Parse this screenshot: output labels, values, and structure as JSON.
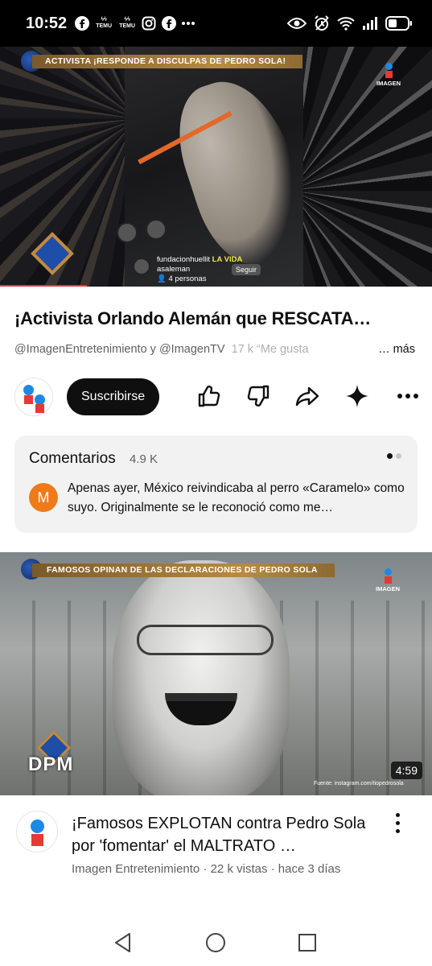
{
  "status_bar": {
    "time": "10:52",
    "temu_label": "TEMU",
    "icons": [
      "facebook-icon",
      "temu-icon",
      "temu-icon",
      "instagram-icon",
      "facebook-icon",
      "more-icon",
      "eye-icon",
      "alarm-icon",
      "wifi-icon",
      "signal-icon",
      "battery-icon"
    ]
  },
  "player": {
    "banner_text": "ACTIVISTA ¡RESPONDE A DISCULPAS DE PEDRO SOLA!",
    "logo_text": "IMAGEN",
    "live_username": "fundacionhuellit",
    "live_overlay_tag": "LA VIDA",
    "live_handle": "asaleman",
    "live_viewers": "4 personas",
    "live_follow": "Seguir"
  },
  "video": {
    "title": "¡Activista Orlando Alemán que RESCATA…",
    "channels": "@ImagenEntretenimiento y @ImagenTV",
    "likes": "17 k “Me gusta",
    "more": "… más",
    "subscribe_label": "Suscribirse"
  },
  "comments": {
    "header": "Comentarios",
    "count": "4.9 K",
    "avatar_letter": "M",
    "text": "Apenas ayer, México reivindicaba al perro «Caramelo» como suyo. Originalmente se le reconoció como me…"
  },
  "next_video": {
    "banner_text": "FAMOSOS OPINAN DE LAS DECLARACIONES DE PEDRO SOLA",
    "logo_text": "IMAGEN",
    "watermark": "DPM",
    "source": "Fuente: instagram.com/tiopedrosola",
    "duration": "4:59",
    "title": "¡Famosos EXPLOTAN contra Pedro Sola por 'fomentar' el MALTRATO …",
    "meta": "Imagen Entretenimiento · 22 k vistas · hace 3 días"
  },
  "colors": {
    "subscribe_bg": "#0f0f0f",
    "comment_avatar": "#ef7a1a",
    "brand_red": "#e53935",
    "brand_blue": "#1e88e5"
  }
}
